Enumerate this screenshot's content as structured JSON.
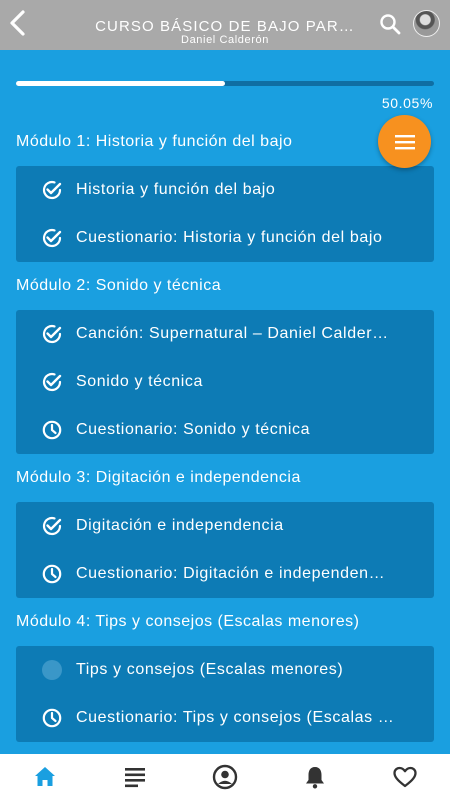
{
  "header": {
    "title": "CURSO BÁSICO DE BAJO PAR…",
    "subtitle": "Daniel Calderón",
    "back_icon": "chevron-left-icon",
    "search_icon": "search-icon"
  },
  "progress": {
    "value": 0.5005,
    "label": "50.05%"
  },
  "fab": {
    "icon": "menu-icon",
    "color": "#f7911f"
  },
  "modules": [
    {
      "title": "Módulo 1: Historia y función del bajo",
      "lessons": [
        {
          "label": "Historia y función del bajo",
          "status": "completed"
        },
        {
          "label": "Cuestionario: Historia y función del bajo",
          "status": "completed"
        }
      ]
    },
    {
      "title": "Módulo 2: Sonido y técnica",
      "lessons": [
        {
          "label": "Canción: Supernatural – Daniel Calder…",
          "status": "completed"
        },
        {
          "label": "Sonido y técnica",
          "status": "completed"
        },
        {
          "label": "Cuestionario: Sonido y técnica",
          "status": "pending"
        }
      ]
    },
    {
      "title": "Módulo 3: Digitación e independencia",
      "lessons": [
        {
          "label": "Digitación e independencia",
          "status": "completed"
        },
        {
          "label": "Cuestionario: Digitación e independen…",
          "status": "pending"
        }
      ]
    },
    {
      "title": "Módulo 4: Tips y consejos (Escalas menores)",
      "lessons": [
        {
          "label": "Tips y consejos (Escalas menores)",
          "status": "not-started"
        },
        {
          "label": "Cuestionario: Tips y consejos (Escalas …",
          "status": "pending"
        }
      ]
    }
  ],
  "bottom_nav": [
    {
      "name": "nav-home",
      "icon": "home-icon",
      "active": true
    },
    {
      "name": "nav-lessons",
      "icon": "list-icon",
      "active": false
    },
    {
      "name": "nav-profile",
      "icon": "account-icon",
      "active": false
    },
    {
      "name": "nav-notifications",
      "icon": "bell-icon",
      "active": false
    },
    {
      "name": "nav-favorites",
      "icon": "heart-icon",
      "active": false
    }
  ],
  "colors": {
    "topbar": "#a9a9a9",
    "background": "#1a9fe0",
    "card": "#0d7bb5",
    "accent": "#f7911f",
    "nav_active": "#1a9fe0",
    "nav_inactive": "#333333"
  }
}
